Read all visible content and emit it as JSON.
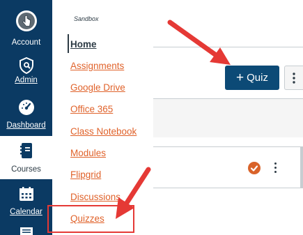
{
  "global_nav": {
    "items": [
      {
        "label": "Account",
        "icon": "account-avatar-icon"
      },
      {
        "label": "Admin",
        "icon": "shield-icon"
      },
      {
        "label": "Dashboard",
        "icon": "dashboard-gauge-icon"
      },
      {
        "label": "Courses",
        "icon": "courses-book-icon",
        "active": true
      },
      {
        "label": "Calendar",
        "icon": "calendar-icon"
      },
      {
        "label": "",
        "icon": "inbox-icon"
      }
    ]
  },
  "course_nav": {
    "course_name": "Sandbox",
    "links": [
      {
        "label": "Home",
        "active": true
      },
      {
        "label": "Assignments"
      },
      {
        "label": "Google Drive"
      },
      {
        "label": "Office 365"
      },
      {
        "label": "Class Notebook"
      },
      {
        "label": "Modules"
      },
      {
        "label": "Flipgrid"
      },
      {
        "label": "Discussions"
      },
      {
        "label": "Quizzes"
      }
    ]
  },
  "toolbar": {
    "add_quiz_label": "Quiz",
    "add_quiz_icon": "plus-icon"
  },
  "colors": {
    "global_nav_bg": "#0b3a63",
    "link_orange": "#e0622a",
    "button_blue": "#0c4a76",
    "annotation_red": "#e53935",
    "published_orange": "#d9632a"
  }
}
